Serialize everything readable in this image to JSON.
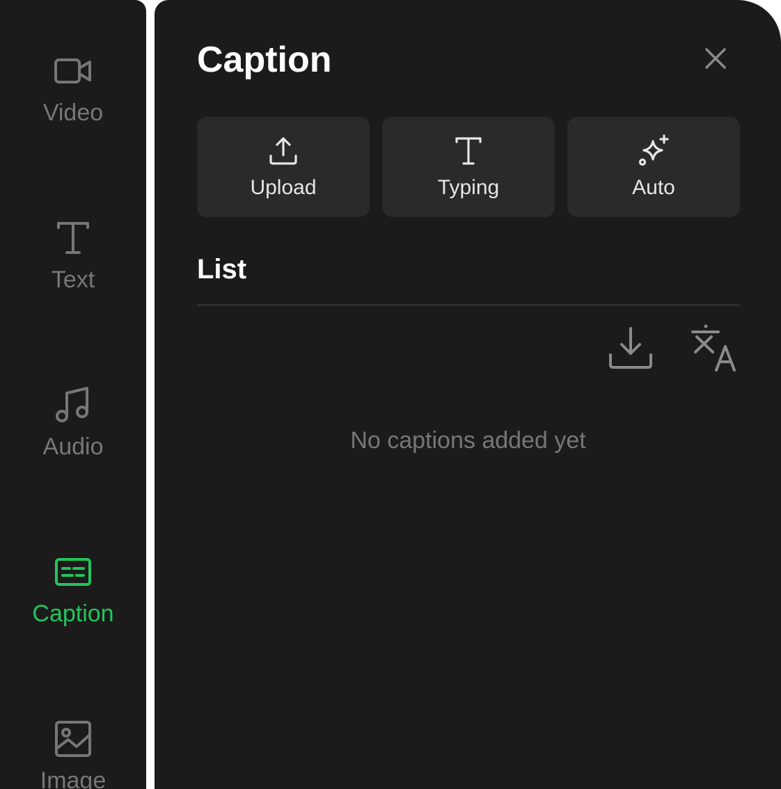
{
  "sidebar": {
    "items": [
      {
        "label": "Video",
        "icon": "video-camera-icon",
        "active": false
      },
      {
        "label": "Text",
        "icon": "text-icon",
        "active": false
      },
      {
        "label": "Audio",
        "icon": "music-note-icon",
        "active": false
      },
      {
        "label": "Caption",
        "icon": "caption-icon",
        "active": true
      },
      {
        "label": "Image",
        "icon": "image-icon",
        "active": false
      }
    ]
  },
  "panel": {
    "title": "Caption",
    "close_icon": "close-icon",
    "tools": [
      {
        "label": "Upload",
        "icon": "upload-icon"
      },
      {
        "label": "Typing",
        "icon": "text-icon"
      },
      {
        "label": "Auto",
        "icon": "sparkle-icon"
      }
    ],
    "list_title": "List",
    "actions": [
      {
        "icon": "download-icon"
      },
      {
        "icon": "translate-icon"
      }
    ],
    "empty_message": "No captions added yet"
  },
  "colors": {
    "background": "#1b1b1b",
    "accent": "#22c55e",
    "button": "#2a2a2a",
    "muted": "#777777"
  }
}
